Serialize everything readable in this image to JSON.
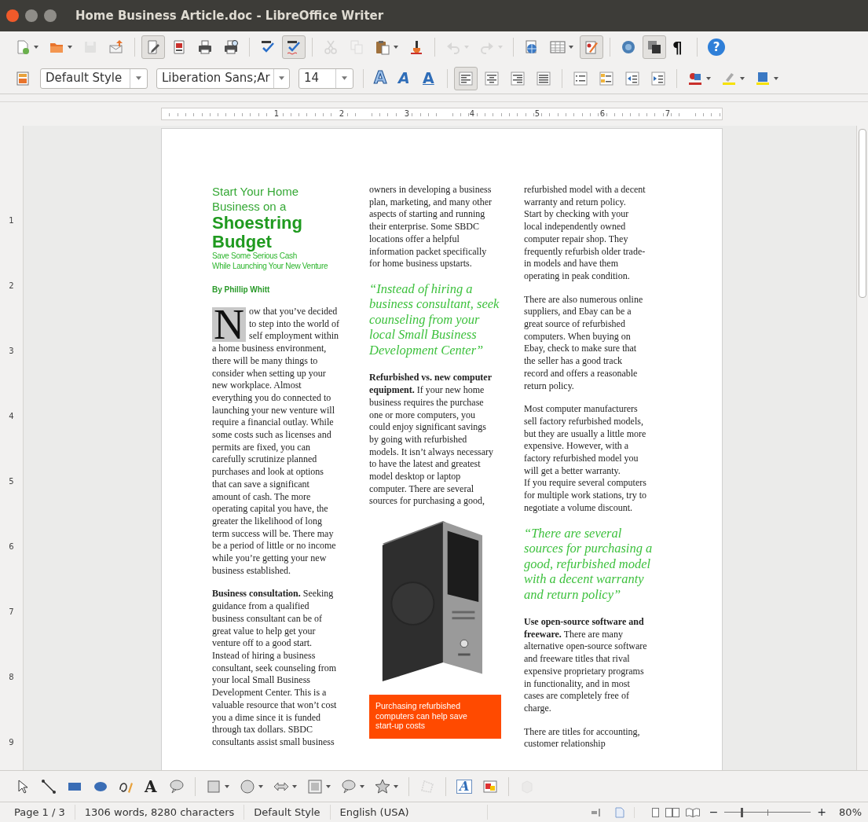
{
  "window": {
    "title": "Home Business Article.doc - LibreOffice Writer"
  },
  "standard_toolbar": [
    {
      "kind": "new",
      "dropdown": true,
      "disabled": false,
      "pressed": false
    },
    {
      "kind": "open",
      "dropdown": true,
      "disabled": false,
      "pressed": false
    },
    {
      "kind": "save",
      "dropdown": false,
      "disabled": true,
      "pressed": false
    },
    {
      "kind": "export",
      "dropdown": false,
      "disabled": false,
      "pressed": false
    },
    {
      "kind": "separator"
    },
    {
      "kind": "edit",
      "dropdown": false,
      "disabled": false,
      "pressed": true
    },
    {
      "kind": "pdf",
      "dropdown": false,
      "disabled": false,
      "pressed": false
    },
    {
      "kind": "print",
      "dropdown": false,
      "disabled": false,
      "pressed": false
    },
    {
      "kind": "preview",
      "dropdown": false,
      "disabled": false,
      "pressed": false
    },
    {
      "kind": "separator"
    },
    {
      "kind": "spell",
      "dropdown": false,
      "disabled": false,
      "pressed": false
    },
    {
      "kind": "autospell",
      "dropdown": false,
      "disabled": false,
      "pressed": true
    },
    {
      "kind": "separator"
    },
    {
      "kind": "cut",
      "dropdown": false,
      "disabled": true,
      "pressed": false
    },
    {
      "kind": "copy",
      "dropdown": false,
      "disabled": true,
      "pressed": false
    },
    {
      "kind": "paste",
      "dropdown": true,
      "disabled": false,
      "pressed": false
    },
    {
      "kind": "clone",
      "dropdown": false,
      "disabled": false,
      "pressed": false
    },
    {
      "kind": "separator"
    },
    {
      "kind": "undo",
      "dropdown": true,
      "disabled": true,
      "pressed": false
    },
    {
      "kind": "redo",
      "dropdown": true,
      "disabled": true,
      "pressed": false
    },
    {
      "kind": "separator"
    },
    {
      "kind": "navigator",
      "dropdown": false,
      "disabled": false,
      "pressed": false
    },
    {
      "kind": "table",
      "dropdown": true,
      "disabled": false,
      "pressed": false
    },
    {
      "kind": "draw",
      "dropdown": false,
      "disabled": false,
      "pressed": true
    },
    {
      "kind": "separator"
    },
    {
      "kind": "gallery",
      "dropdown": false,
      "disabled": false,
      "pressed": false
    },
    {
      "kind": "pages",
      "dropdown": false,
      "disabled": false,
      "pressed": true
    },
    {
      "kind": "pilcrow",
      "label": "¶",
      "dropdown": false,
      "disabled": false,
      "pressed": false
    },
    {
      "kind": "separator"
    },
    {
      "kind": "help",
      "label": "?",
      "dropdown": false,
      "disabled": false,
      "pressed": false
    }
  ],
  "formatting_toolbar": [
    {
      "kind": "styles",
      "dropdown": false,
      "disabled": false,
      "pressed": false
    },
    {
      "kind": "style-combo",
      "value": "Default Style"
    },
    {
      "kind": "font-combo",
      "value": "Liberation Sans;Ar"
    },
    {
      "kind": "size-combo",
      "value": "14"
    },
    {
      "kind": "separator"
    },
    {
      "kind": "outline-a",
      "label": "A",
      "dropdown": false,
      "disabled": false,
      "pressed": false
    },
    {
      "kind": "shadow-a",
      "label": "A",
      "dropdown": false,
      "disabled": false,
      "pressed": false
    },
    {
      "kind": "underline-a",
      "label": "A",
      "dropdown": false,
      "disabled": false,
      "pressed": false
    },
    {
      "kind": "separator"
    },
    {
      "kind": "align-left",
      "dropdown": false,
      "disabled": false,
      "pressed": true
    },
    {
      "kind": "align-center",
      "dropdown": false,
      "disabled": false,
      "pressed": false
    },
    {
      "kind": "align-right",
      "dropdown": false,
      "disabled": false,
      "pressed": false
    },
    {
      "kind": "justify",
      "dropdown": false,
      "disabled": false,
      "pressed": false
    },
    {
      "kind": "separator"
    },
    {
      "kind": "numbering",
      "dropdown": false,
      "disabled": false,
      "pressed": false
    },
    {
      "kind": "bullets",
      "dropdown": false,
      "disabled": false,
      "pressed": false
    },
    {
      "kind": "outdent",
      "dropdown": false,
      "disabled": false,
      "pressed": false
    },
    {
      "kind": "indent",
      "dropdown": false,
      "disabled": false,
      "pressed": false
    },
    {
      "kind": "separator"
    },
    {
      "kind": "font-color",
      "dropdown": true,
      "disabled": false,
      "pressed": false
    },
    {
      "kind": "highlight",
      "dropdown": true,
      "disabled": false,
      "pressed": false
    },
    {
      "kind": "bg-color",
      "dropdown": true,
      "disabled": false,
      "pressed": false
    }
  ],
  "ruler": {
    "marks": [
      "1",
      "2",
      "3",
      "4",
      "5",
      "6",
      "7"
    ]
  },
  "vertical_ruler": {
    "marks": [
      "1",
      "2",
      "3",
      "4",
      "5",
      "6",
      "7",
      "8",
      "9"
    ]
  },
  "columns": [
    {
      "blocks": [
        {
          "kind": "kicker",
          "lines": [
            "Start Your Home",
            "Business on a"
          ]
        },
        {
          "kind": "headline",
          "lines": [
            "Shoestring",
            "Budget"
          ]
        },
        {
          "kind": "subtitle",
          "lines": [
            "Save Some Serious Cash",
            "While Launching Your New Venture"
          ]
        },
        {
          "kind": "byline",
          "lines": [
            "By Phillip Whitt"
          ]
        },
        {
          "kind": "paragraph",
          "drop_cap": "N",
          "lines": [
            "ow that you’ve decided",
            "to step into the world of",
            "self employment within",
            "a home business environment,",
            "there will be many things to",
            "consider when setting up your",
            "new workplace. Almost",
            "everything you do connected to",
            "launching your new venture will",
            "require a financial outlay. While",
            "some costs such as licenses and",
            "permits are fixed, you can",
            "carefully scrutinize planned",
            "purchases and look at options",
            "that can save a significant",
            "amount of cash. The more",
            "operating capital you have, the",
            "greater the likelihood of long",
            "term success will be. There may",
            "be a period of little or no income",
            "while you’re getting your new",
            "business established."
          ]
        },
        {
          "kind": "paragraph",
          "lines": [
            "**Business consultation.** Seeking",
            "guidance from a qualified",
            "business consultant can be of",
            "great value to help get your",
            "venture off to a good start.",
            "Instead of hiring a business",
            "consultant, seek counseling from",
            "your local Small Business",
            "Development Center. This is a",
            "valuable resource that won’t cost",
            "you a dime since it is funded",
            "through tax dollars. SBDC",
            "consultants assist small business"
          ]
        }
      ]
    },
    {
      "blocks": [
        {
          "kind": "paragraph",
          "lines": [
            "owners in developing a business",
            "plan, marketing, and many other",
            "aspects of starting and running",
            "their enterprise. Some SBDC",
            "locations offer a helpful",
            "information packet specifically",
            "for home business upstarts."
          ]
        },
        {
          "kind": "quote",
          "lines": [
            "“Instead of hiring a",
            "business consultant, seek",
            "counseling from your",
            "local Small Business",
            "Development Center”"
          ]
        },
        {
          "kind": "paragraph",
          "lines": [
            "**Refurbished vs. new computer**",
            "**equipment.** If your new home",
            "business requires the purchase",
            "one or more computers, you",
            "could enjoy significant savings",
            "by going with refurbished",
            "models. It isn’t always necessary",
            "to have the latest and greatest",
            "model desktop or laptop",
            "computer. There are several",
            "sources for purchasing a good,"
          ]
        },
        {
          "kind": "figure"
        },
        {
          "kind": "caption",
          "lines": [
            "Purchasing refurbished",
            "computers can help save",
            "start-up costs"
          ]
        }
      ]
    },
    {
      "blocks": [
        {
          "kind": "paragraph",
          "lines": [
            "refurbished model with a decent",
            "warranty and return policy.",
            "Start by checking with your",
            "local independently owned",
            "computer repair shop. They",
            "frequently refurbish older trade-",
            "in models and have them",
            "operating in peak condition."
          ]
        },
        {
          "kind": "paragraph",
          "lines": [
            "There are also numerous online",
            "suppliers, and Ebay can be a",
            "great source of refurbished",
            "computers. When buying on",
            "Ebay, check to make sure that",
            "the seller has a good track",
            "record and offers a reasonable",
            "return policy."
          ]
        },
        {
          "kind": "paragraph",
          "lines": [
            "Most computer manufacturers",
            "sell factory refurbished models,",
            "but they are usually a little more",
            "expensive. However, with a",
            "factory refurbished model you",
            "will get a better warranty.",
            "If you require several computers",
            "for multiple work stations, try to",
            "negotiate a volume discount."
          ]
        },
        {
          "kind": "quote",
          "lines": [
            "“There are several",
            "sources for purchasing a",
            "good, refurbished model",
            "with a decent warranty",
            "and return policy”"
          ]
        },
        {
          "kind": "paragraph",
          "lines": [
            "**Use open-source software and**",
            "**freeware.** There are many",
            "alternative open-source software",
            "and freeware titles that rival",
            "expensive proprietary programs",
            "in functionality, and in most",
            "cases are completely free of",
            "charge."
          ]
        },
        {
          "kind": "paragraph",
          "lines": [
            "There are titles for accounting,",
            "customer relationship"
          ]
        }
      ]
    }
  ],
  "drawing_toolbar": [
    {
      "kind": "select",
      "dropdown": false,
      "disabled": false,
      "pressed": false
    },
    {
      "kind": "line",
      "dropdown": false,
      "disabled": false,
      "pressed": false
    },
    {
      "kind": "rect",
      "dropdown": false,
      "disabled": false,
      "pressed": false
    },
    {
      "kind": "ellipse",
      "dropdown": false,
      "disabled": false,
      "pressed": false
    },
    {
      "kind": "freeform",
      "dropdown": false,
      "disabled": false,
      "pressed": false
    },
    {
      "kind": "text-tool",
      "label": "A",
      "dropdown": false,
      "disabled": false,
      "pressed": false
    },
    {
      "kind": "callout",
      "dropdown": false,
      "disabled": false,
      "pressed": false
    },
    {
      "kind": "separator"
    },
    {
      "kind": "basic-shapes",
      "dropdown": true,
      "disabled": false,
      "pressed": false
    },
    {
      "kind": "symbol-shapes",
      "dropdown": true,
      "disabled": false,
      "pressed": false
    },
    {
      "kind": "block-arrows",
      "dropdown": true,
      "disabled": false,
      "pressed": false
    },
    {
      "kind": "flowchart",
      "dropdown": true,
      "disabled": false,
      "pressed": false
    },
    {
      "kind": "callouts",
      "dropdown": true,
      "disabled": false,
      "pressed": false
    },
    {
      "kind": "stars",
      "dropdown": true,
      "disabled": false,
      "pressed": false
    },
    {
      "kind": "separator"
    },
    {
      "kind": "points",
      "dropdown": false,
      "disabled": true,
      "pressed": false
    },
    {
      "kind": "separator"
    },
    {
      "kind": "fontwork",
      "label": "A",
      "dropdown": false,
      "disabled": false,
      "pressed": false
    },
    {
      "kind": "image",
      "dropdown": false,
      "disabled": false,
      "pressed": false
    },
    {
      "kind": "separator"
    },
    {
      "kind": "extrusion",
      "dropdown": false,
      "disabled": true,
      "pressed": false
    }
  ],
  "status_bar": {
    "page": "Page 1 / 3",
    "counts": "1306 words, 8280 characters",
    "style": "Default Style",
    "language": "English (USA)",
    "zoom_out": "−",
    "zoom": {
      "level": 0.2
    },
    "zoom_in": "+",
    "zoom_percent": "80%"
  }
}
